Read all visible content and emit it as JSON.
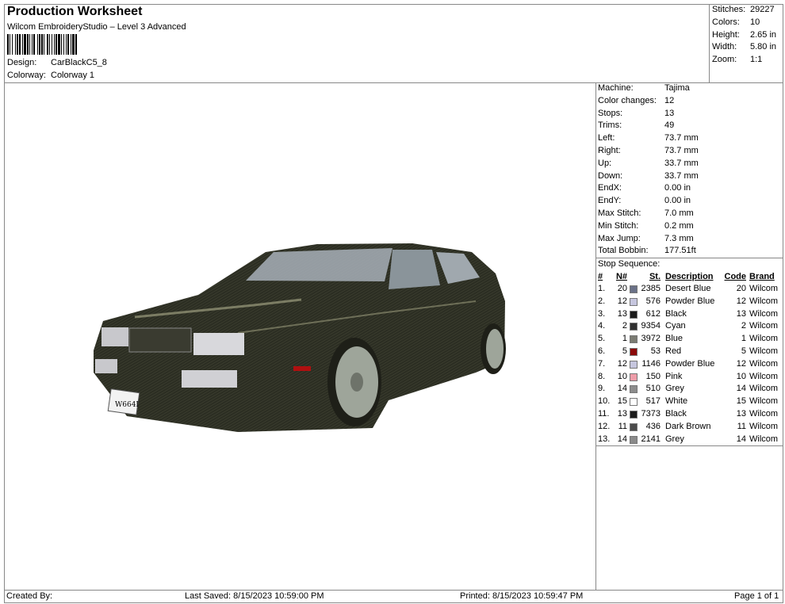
{
  "header": {
    "title": "Production Worksheet",
    "subtitle": "Wilcom EmbroideryStudio – Level 3 Advanced",
    "design_label": "Design:",
    "design": "CarBlackC5_8",
    "colorway_label": "Colorway:",
    "colorway": "Colorway 1"
  },
  "stats": [
    {
      "label": "Stitches:",
      "value": "29227"
    },
    {
      "label": "Colors:",
      "value": "10"
    },
    {
      "label": "Height:",
      "value": "2.65 in"
    },
    {
      "label": "Width:",
      "value": "5.80 in"
    },
    {
      "label": "Zoom:",
      "value": "1:1"
    }
  ],
  "info": [
    {
      "label": "Machine:",
      "value": "Tajima"
    },
    {
      "label": "Color changes:",
      "value": "12"
    },
    {
      "label": "Stops:",
      "value": "13"
    },
    {
      "label": "Trims:",
      "value": "49"
    },
    {
      "label": "Left:",
      "value": "73.7 mm"
    },
    {
      "label": "Right:",
      "value": "73.7 mm"
    },
    {
      "label": "Up:",
      "value": "33.7 mm"
    },
    {
      "label": "Down:",
      "value": "33.7 mm"
    },
    {
      "label": "EndX:",
      "value": "0.00 in"
    },
    {
      "label": "EndY:",
      "value": "0.00 in"
    },
    {
      "label": "Max Stitch:",
      "value": "7.0 mm"
    },
    {
      "label": "Min Stitch:",
      "value": "0.2 mm"
    },
    {
      "label": "Max Jump:",
      "value": "7.3 mm"
    },
    {
      "label": "Total Bobbin:",
      "value": "177.51ft"
    }
  ],
  "stop_sequence": {
    "title": "Stop Sequence:",
    "columns": [
      "#",
      "N#",
      "St.",
      "Description",
      "Code",
      "Brand"
    ],
    "rows": [
      {
        "num": "1.",
        "n": "20",
        "color": "#6a7187",
        "st": "2385",
        "desc": "Desert Blue",
        "code": "20",
        "brand": "Wilcom"
      },
      {
        "num": "2.",
        "n": "12",
        "color": "#c6c6de",
        "st": "576",
        "desc": "Powder Blue",
        "code": "12",
        "brand": "Wilcom"
      },
      {
        "num": "3.",
        "n": "13",
        "color": "#1a1a1a",
        "st": "612",
        "desc": "Black",
        "code": "13",
        "brand": "Wilcom"
      },
      {
        "num": "4.",
        "n": "2",
        "color": "#2f2f2f",
        "st": "9354",
        "desc": "Cyan",
        "code": "2",
        "brand": "Wilcom"
      },
      {
        "num": "5.",
        "n": "1",
        "color": "#7a7b72",
        "st": "3972",
        "desc": "Blue",
        "code": "1",
        "brand": "Wilcom"
      },
      {
        "num": "6.",
        "n": "5",
        "color": "#8b0a0a",
        "st": "53",
        "desc": "Red",
        "code": "5",
        "brand": "Wilcom"
      },
      {
        "num": "7.",
        "n": "12",
        "color": "#c6c6de",
        "st": "1146",
        "desc": "Powder Blue",
        "code": "12",
        "brand": "Wilcom"
      },
      {
        "num": "8.",
        "n": "10",
        "color": "#ee9ca8",
        "st": "150",
        "desc": "Pink",
        "code": "10",
        "brand": "Wilcom"
      },
      {
        "num": "9.",
        "n": "14",
        "color": "#8c8c8c",
        "st": "510",
        "desc": "Grey",
        "code": "14",
        "brand": "Wilcom"
      },
      {
        "num": "10.",
        "n": "15",
        "color": "#ffffff",
        "st": "517",
        "desc": "White",
        "code": "15",
        "brand": "Wilcom"
      },
      {
        "num": "11.",
        "n": "13",
        "color": "#1a1a1a",
        "st": "7373",
        "desc": "Black",
        "code": "13",
        "brand": "Wilcom"
      },
      {
        "num": "12.",
        "n": "11",
        "color": "#4a4a4a",
        "st": "436",
        "desc": "Dark Brown",
        "code": "11",
        "brand": "Wilcom"
      },
      {
        "num": "13.",
        "n": "14",
        "color": "#8a8a8a",
        "st": "2141",
        "desc": "Grey",
        "code": "14",
        "brand": "Wilcom"
      }
    ]
  },
  "footer": {
    "created_by": "Created By:",
    "last_saved": "Last Saved: 8/15/2023 10:59:00 PM",
    "printed": "Printed: 8/15/2023 10:59:47 PM",
    "page": "Page 1 of 1"
  },
  "design_preview": {
    "plate_text": "W664I"
  }
}
